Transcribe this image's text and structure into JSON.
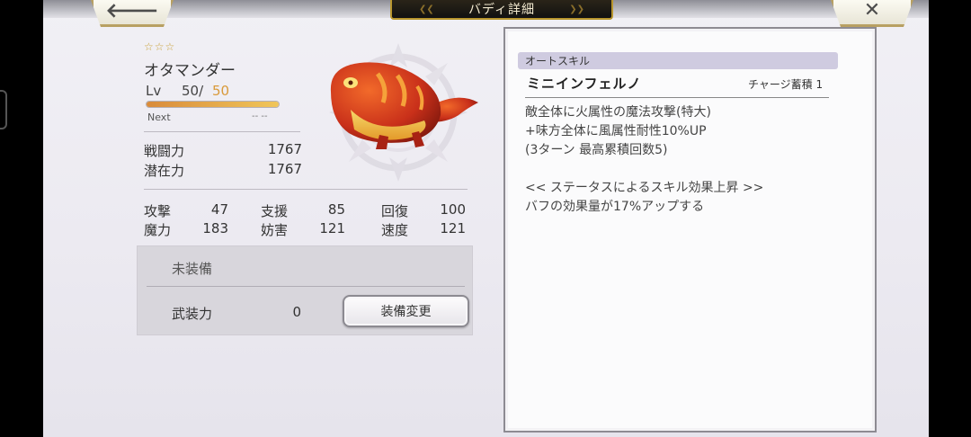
{
  "header": {
    "title": "バディ詳細",
    "back_icon": "arrow-left-icon",
    "close_icon": "close-x-icon",
    "back_glyph": "🡐",
    "close_glyph": "✕"
  },
  "buddy": {
    "rarity_stars": "☆☆☆",
    "name": "オタマンダー",
    "level_label": "Lv",
    "level_current": "50/",
    "level_max": "50",
    "exp_fraction": 1.0,
    "next_label": "Next",
    "next_value": "-- --"
  },
  "power": [
    {
      "label": "戦闘力",
      "value": "1767"
    },
    {
      "label": "潜在力",
      "value": "1767"
    }
  ],
  "stats": [
    {
      "label": "攻撃",
      "value": "47"
    },
    {
      "label": "支援",
      "value": "85"
    },
    {
      "label": "回復",
      "value": "100"
    },
    {
      "label": "魔力",
      "value": "183"
    },
    {
      "label": "妨害",
      "value": "121"
    },
    {
      "label": "速度",
      "value": "121"
    }
  ],
  "equipment": {
    "status": "未装備",
    "armor_label": "武装力",
    "armor_value": "0",
    "change_button": "装備変更"
  },
  "skill": {
    "section_label": "オートスキル",
    "name": "ミニインフェルノ",
    "charge": "チャージ蓄積 1",
    "description": [
      "敵全体に火属性の魔法攻撃(特大)",
      "+味方全体に風属性耐性10%UP",
      "(3ターン 最高累積回数5)",
      "",
      "<< ステータスによるスキル効果上昇 >>",
      "バフの効果量が17%アップする"
    ]
  },
  "colors": {
    "gold_border": "#b8a062",
    "level_max": "#d99a3a",
    "skill_header_bg": "#cfcbe0",
    "creature_main": "#d83a1a",
    "creature_belly": "#f2c24a"
  }
}
